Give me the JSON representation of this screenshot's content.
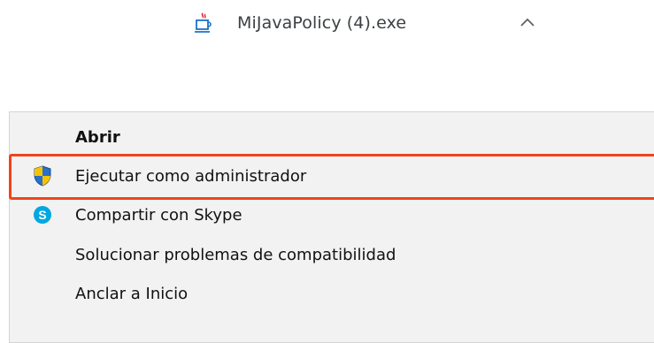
{
  "download": {
    "file_name": "MiJavaPolicy (4).exe",
    "file_icon": "java-cup-icon",
    "chevron_icon": "chevron-up-icon"
  },
  "context_menu": {
    "items": [
      {
        "label": "Abrir",
        "bold": true
      },
      {
        "label": "Ejecutar como administrador",
        "icon": "uac-shield-icon",
        "highlighted": true
      },
      {
        "label": "Compartir con Skype",
        "icon": "skype-icon"
      },
      {
        "label": "Solucionar problemas de compatibilidad"
      },
      {
        "label": "Anclar a Inicio"
      }
    ]
  },
  "colors": {
    "highlight": "#f0441a",
    "menu_background": "#f2f2f2",
    "skype": "#00a7e1",
    "shield_blue": "#2a6fc9",
    "shield_yellow": "#f5c400"
  }
}
